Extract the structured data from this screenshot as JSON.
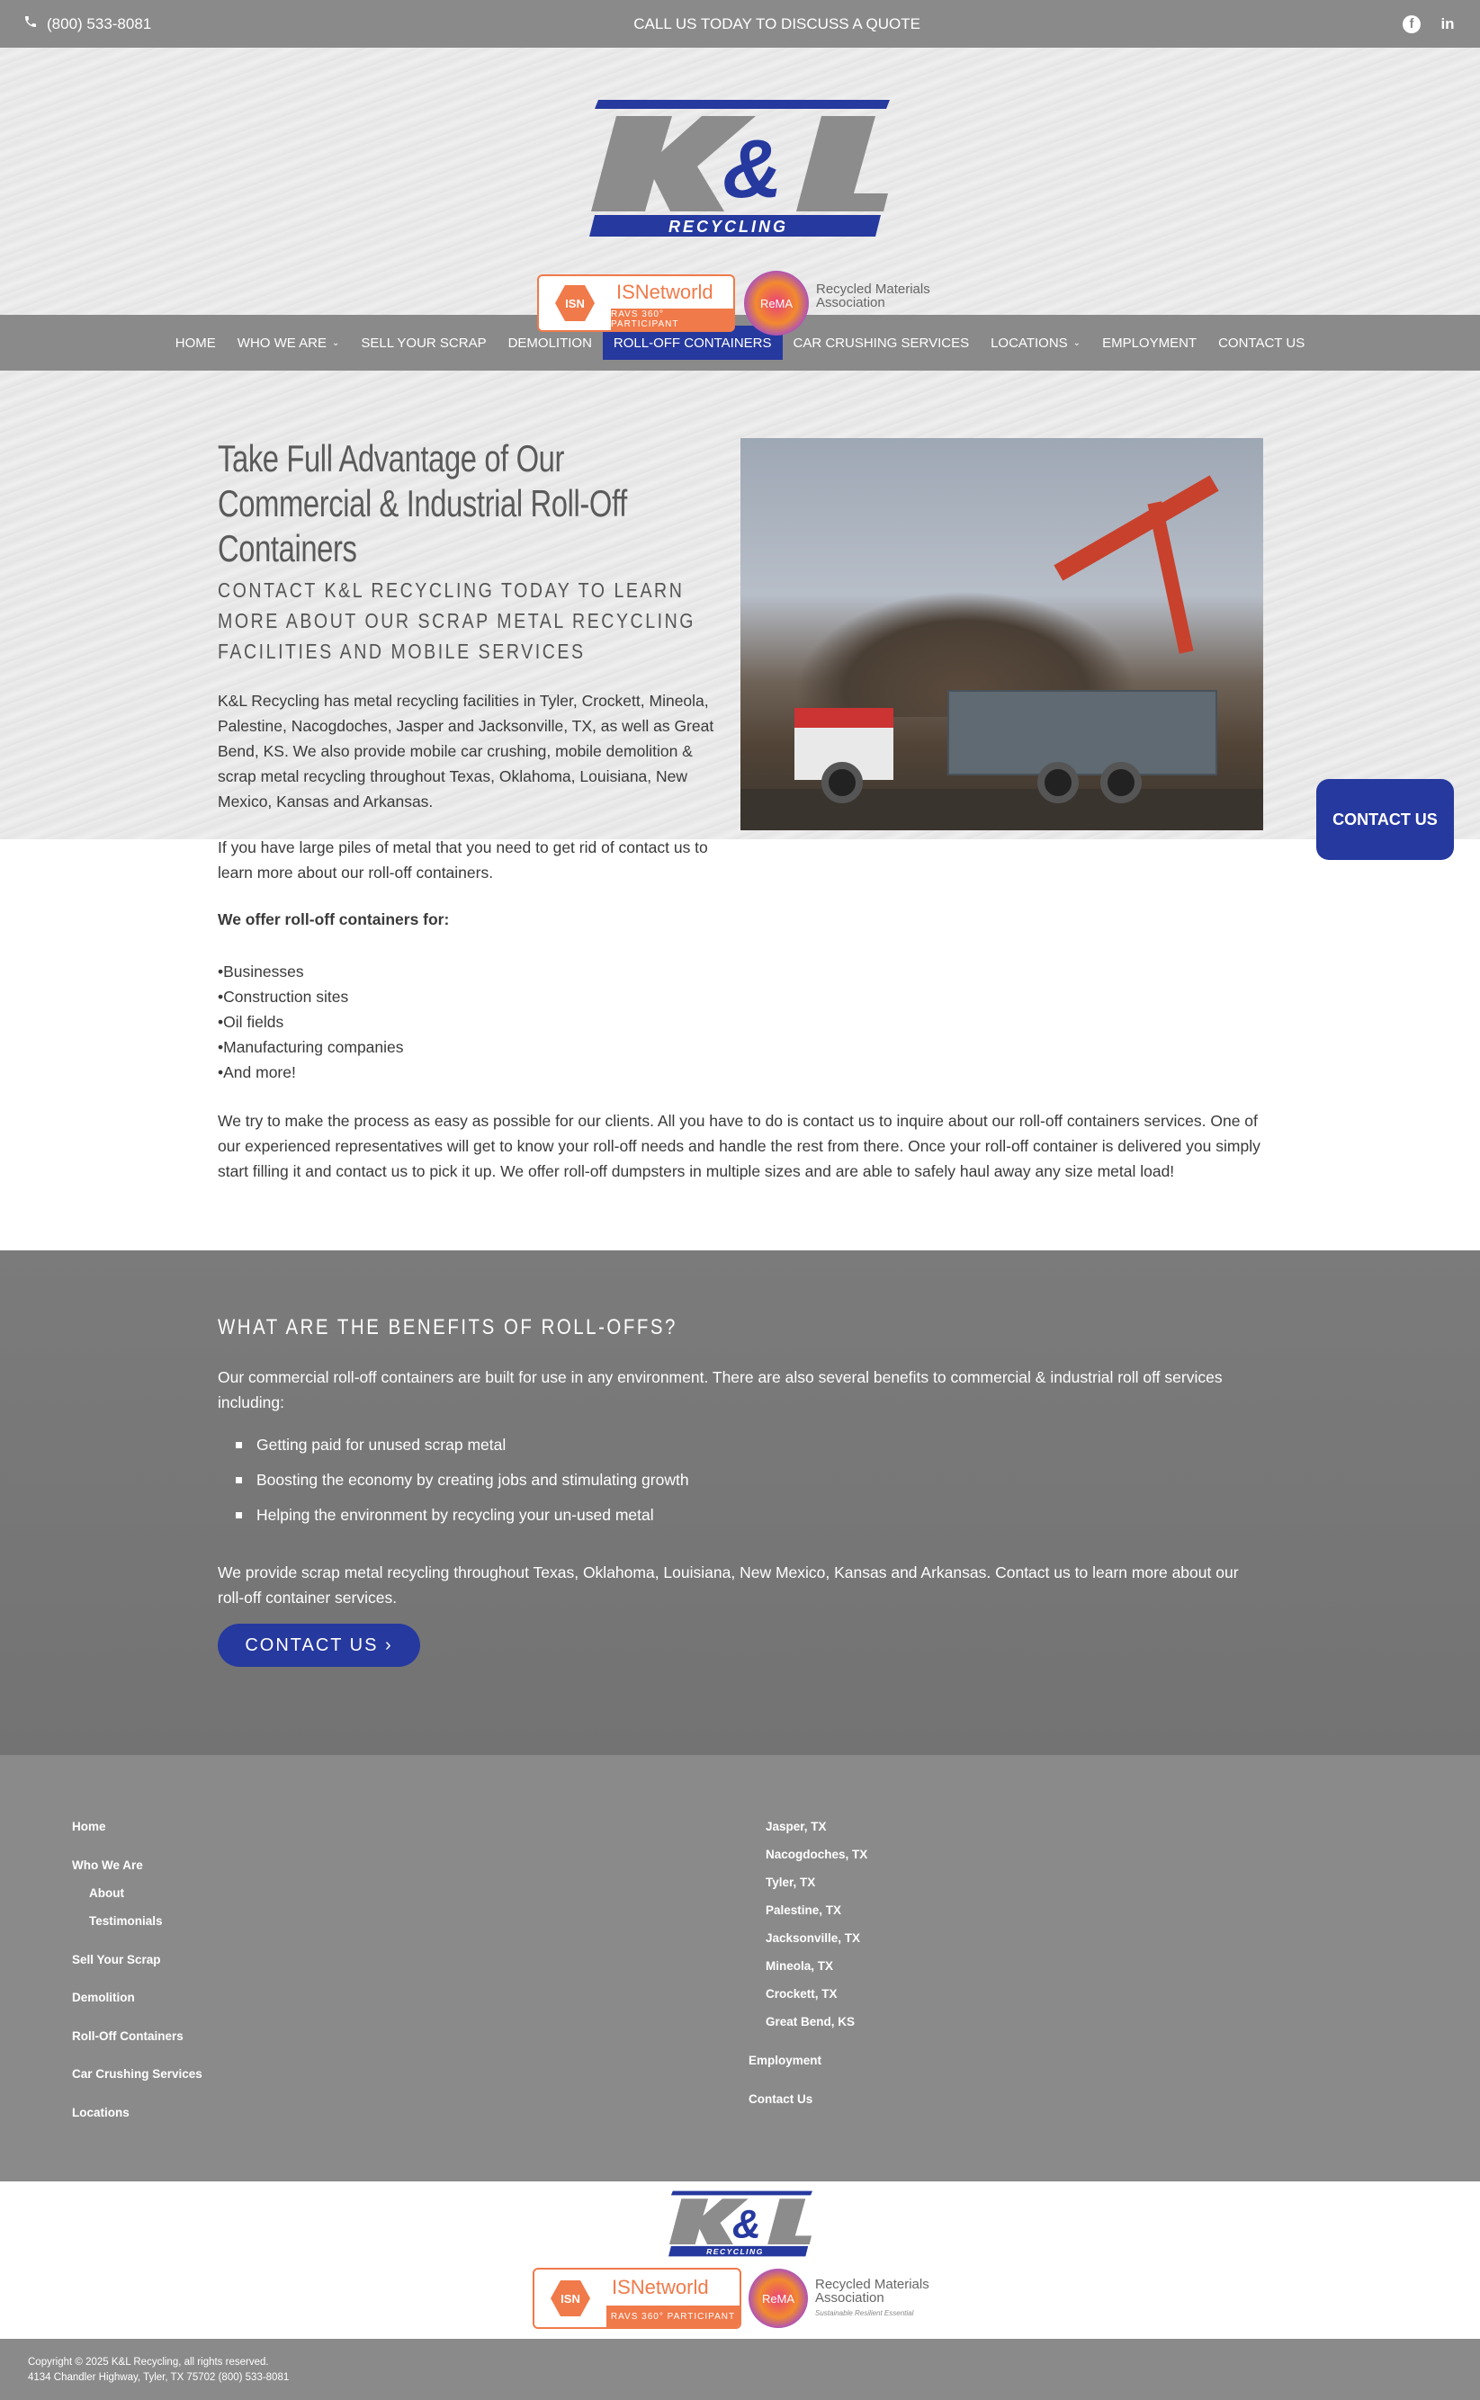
{
  "topbar": {
    "phone": "(800) 533-8081",
    "cta": "CALL US TODAY TO DISCUSS A QUOTE",
    "social": [
      "facebook-icon",
      "linkedin-icon"
    ]
  },
  "logo": {
    "main": "K&L",
    "sub": "RECYCLING"
  },
  "badges": {
    "isn_brand": "ISNetworld",
    "isn_mark": "ISN",
    "isn_sub": "RAVS 360° PARTICIPANT",
    "rema_mark": "ReMA",
    "rema_name": "Recycled Materials Association",
    "rema_tag": "Sustainable Resilient Essential"
  },
  "nav": {
    "items": [
      {
        "label": "HOME"
      },
      {
        "label": "WHO WE ARE",
        "dropdown": true
      },
      {
        "label": "SELL YOUR SCRAP"
      },
      {
        "label": "DEMOLITION"
      },
      {
        "label": "ROLL-OFF CONTAINERS",
        "active": true
      },
      {
        "label": "CAR CRUSHING SERVICES"
      },
      {
        "label": "LOCATIONS",
        "dropdown": true
      },
      {
        "label": "EMPLOYMENT"
      },
      {
        "label": "CONTACT US"
      }
    ]
  },
  "hero": {
    "title_line1": "Take Full Advantage of Our",
    "title_line2": "Commercial & Industrial Roll-Off",
    "title_line3": "Containers",
    "subtitle": "CONTACT K&L RECYCLING TODAY TO LEARN MORE ABOUT OUR SCRAP METAL RECYCLING FACILITIES AND MOBILE SERVICES",
    "para1": "K&L Recycling has metal recycling facilities in Tyler, Crockett, Mineola, Palestine, Nacogdoches, Jasper and Jacksonville, TX, as well as Great Bend, KS. We also provide mobile car crushing, mobile demolition & scrap metal recycling throughout Texas, Oklahoma, Louisiana, New Mexico, Kansas and Arkansas.",
    "para2": "If you have large piles of metal that you need to get rid of contact us to learn more about our roll-off containers.",
    "offer_heading": "We offer roll-off containers for:",
    "offer_items": [
      "•Businesses",
      "•Construction sites",
      "•Oil fields",
      "•Manufacturing companies",
      "•And more!"
    ],
    "para3": "We try to make the process as easy as possible for our clients. All you have to do is contact us to inquire about our roll-off containers services. One of our experienced representatives will get to know your roll-off needs and handle the rest from there. Once your roll-off container is delivered you simply start filling it and contact us to pick it up. We offer roll-off dumpsters in multiple sizes and are able to safely haul away any size metal load!"
  },
  "floating_contact": "CONTACT US",
  "benefits": {
    "heading": "WHAT ARE THE BENEFITS OF ROLL-OFFS?",
    "intro": "Our commercial roll-off containers are built for use in any environment. There are also several benefits to commercial & industrial roll off services including:",
    "items": [
      "Getting paid for unused scrap metal",
      "Boosting the economy by creating jobs and stimulating growth",
      "Helping the environment by recycling your un-used metal"
    ],
    "outro": "We provide scrap metal recycling throughout Texas, Oklahoma, Louisiana, New Mexico, Kansas and Arkansas. Contact us to learn more about our roll-off container services.",
    "button": "CONTACT US  ›"
  },
  "footer_nav": {
    "left": [
      "Home",
      "Who We Are",
      "About",
      "Testimonials",
      "Sell Your Scrap",
      "Demolition",
      "Roll-Off Containers",
      "Car Crushing Services",
      "Locations"
    ],
    "right": [
      "Jasper, TX",
      "Nacogdoches, TX",
      "Tyler, TX",
      "Palestine, TX",
      "Jacksonville, TX",
      "Mineola, TX",
      "Crockett, TX",
      "Great Bend, KS",
      "Employment",
      "Contact Us"
    ]
  },
  "copyright": {
    "line1": "Copyright © 2025 K&L Recycling, all rights reserved.",
    "line2": "4134 Chandler Highway,  Tyler, TX 75702   (800) 533-8081"
  }
}
